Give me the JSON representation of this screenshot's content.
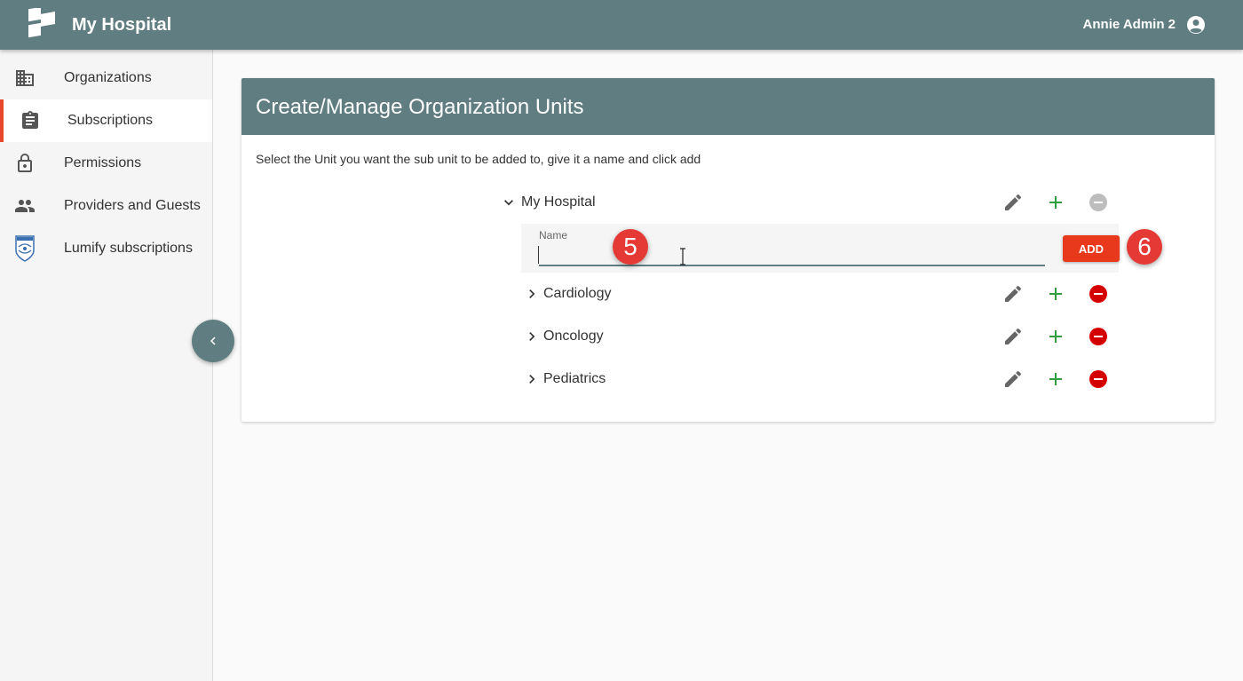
{
  "header": {
    "app_title": "My Hospital",
    "user_name": "Annie Admin 2",
    "brand_color": "#607d82"
  },
  "sidebar": {
    "items": [
      {
        "label": "Organizations",
        "icon": "building-icon",
        "active": false
      },
      {
        "label": "Subscriptions",
        "icon": "clipboard-icon",
        "active": true
      },
      {
        "label": "Permissions",
        "icon": "lock-icon",
        "active": false
      },
      {
        "label": "Providers and Guests",
        "icon": "people-icon",
        "active": false
      },
      {
        "label": "Lumify subscriptions",
        "icon": "philips-shield-icon",
        "active": false
      }
    ],
    "active_accent": "#e8472b"
  },
  "card": {
    "title": "Create/Manage Organization Units",
    "instruction": "Select the Unit you want the sub unit to be added to, give it a name and click add"
  },
  "tree": {
    "root": {
      "label": "My Hospital",
      "expanded": true
    },
    "add_form": {
      "field_label": "Name",
      "value": "",
      "add_label": "ADD"
    },
    "children": [
      {
        "label": "Cardiology"
      },
      {
        "label": "Oncology"
      },
      {
        "label": "Pediatrics"
      }
    ]
  },
  "annotations": {
    "step_input": "5",
    "step_add": "6"
  },
  "colors": {
    "add_green": "#2e9e3e",
    "remove_red": "#d50000",
    "remove_disabled": "#bdbdbd",
    "add_button": "#e8391c"
  }
}
